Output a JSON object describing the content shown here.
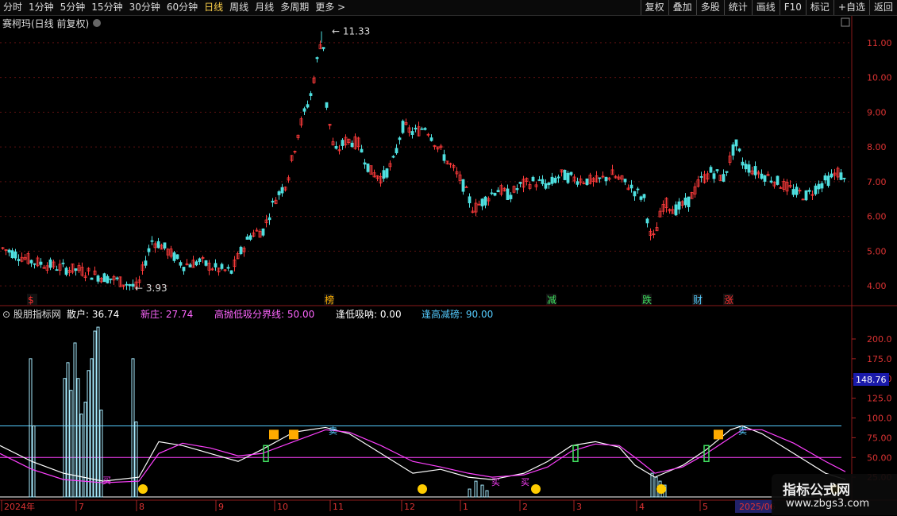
{
  "toolbar": {
    "left": [
      "分时",
      "1分钟",
      "5分钟",
      "15分钟",
      "30分钟",
      "60分钟",
      "日线",
      "周线",
      "月线",
      "多周期",
      "更多 >"
    ],
    "active": "日线",
    "right": [
      "复权",
      "叠加",
      "多股",
      "统计",
      "画线",
      "F10",
      "标记",
      "+自选",
      "返回"
    ]
  },
  "main": {
    "title": "赛柯玛(日线 前复权)",
    "high_label": "11.33",
    "low_label": "3.93",
    "y_ticks": [
      "11.00",
      "10.00",
      "9.00",
      "8.00",
      "7.00",
      "6.00",
      "5.00",
      "4.00"
    ],
    "markers": [
      "$",
      "榜",
      "减",
      "跌",
      "财",
      "涨"
    ]
  },
  "indicator": {
    "name": "股朋指标网",
    "items": [
      {
        "label": "散户: 36.74",
        "color": "#ffffff"
      },
      {
        "label": "新庄: 27.74",
        "color": "#ff66ff"
      },
      {
        "label": "高抛低吸分界线: 50.00",
        "color": "#ff66ff"
      },
      {
        "label": "逢低吸呐: 0.00",
        "color": "#ffffff"
      },
      {
        "label": "逢高减磅: 90.00",
        "color": "#55ccff"
      }
    ],
    "y_ticks": [
      "200.0",
      "175.0",
      "150.0",
      "125.0",
      "100.0",
      "75.00",
      "50.00",
      "25.00"
    ],
    "current_value": "148.76",
    "signal_text": {
      "buy": "买",
      "sell": "卖"
    }
  },
  "x_axis": {
    "labels": [
      "2024年",
      "7",
      "8",
      "9",
      "10",
      "11",
      "12",
      "1",
      "2",
      "3",
      "4",
      "5",
      "2025/06"
    ]
  },
  "watermark": {
    "line1": "指标公式网",
    "line2": "www.zbgs3.com"
  },
  "colors": {
    "up": "#ff3b3b",
    "down": "#4fe0e0",
    "grid": "#5a1010",
    "accent": "#ffd24a",
    "magenta": "#ff40ff",
    "cyan": "#55ccff"
  },
  "chart_data": {
    "type": "candlestick",
    "price_range": [
      3.5,
      11.5
    ],
    "price_path": [
      [
        0,
        5.1
      ],
      [
        20,
        4.9
      ],
      [
        40,
        4.7
      ],
      [
        60,
        4.6
      ],
      [
        80,
        4.5
      ],
      [
        100,
        4.45
      ],
      [
        120,
        4.3
      ],
      [
        140,
        4.2
      ],
      [
        160,
        4.05
      ],
      [
        172,
        3.93
      ],
      [
        180,
        4.6
      ],
      [
        190,
        5.3
      ],
      [
        200,
        5.2
      ],
      [
        215,
        4.9
      ],
      [
        230,
        4.6
      ],
      [
        250,
        4.7
      ],
      [
        270,
        4.5
      ],
      [
        290,
        4.4
      ],
      [
        300,
        4.9
      ],
      [
        315,
        5.5
      ],
      [
        330,
        5.6
      ],
      [
        345,
        6.5
      ],
      [
        360,
        7.0
      ],
      [
        375,
        8.5
      ],
      [
        390,
        9.5
      ],
      [
        405,
        11.33
      ],
      [
        410,
        9.2
      ],
      [
        420,
        7.8
      ],
      [
        435,
        8.2
      ],
      [
        450,
        8.1
      ],
      [
        465,
        7.3
      ],
      [
        480,
        7.1
      ],
      [
        495,
        7.6
      ],
      [
        505,
        8.6
      ],
      [
        520,
        8.4
      ],
      [
        535,
        8.6
      ],
      [
        550,
        8.0
      ],
      [
        565,
        7.5
      ],
      [
        580,
        7.0
      ],
      [
        595,
        6.2
      ],
      [
        610,
        6.5
      ],
      [
        625,
        6.8
      ],
      [
        640,
        6.6
      ],
      [
        655,
        6.9
      ],
      [
        670,
        7.0
      ],
      [
        690,
        6.9
      ],
      [
        705,
        7.2
      ],
      [
        720,
        7.1
      ],
      [
        735,
        7.05
      ],
      [
        750,
        7.0
      ],
      [
        770,
        7.2
      ],
      [
        790,
        6.9
      ],
      [
        810,
        6.5
      ],
      [
        820,
        5.2
      ],
      [
        835,
        6.4
      ],
      [
        850,
        6.2
      ],
      [
        865,
        6.4
      ],
      [
        880,
        7.0
      ],
      [
        895,
        7.3
      ],
      [
        910,
        7.1
      ],
      [
        925,
        8.1
      ],
      [
        935,
        7.5
      ],
      [
        950,
        7.3
      ],
      [
        970,
        7.1
      ],
      [
        985,
        6.9
      ],
      [
        1000,
        6.7
      ],
      [
        1015,
        6.6
      ],
      [
        1030,
        6.9
      ],
      [
        1045,
        7.1
      ],
      [
        1055,
        7.3
      ],
      [
        1062,
        7.0
      ]
    ],
    "osc_white": [
      [
        0,
        65
      ],
      [
        40,
        45
      ],
      [
        80,
        30
      ],
      [
        130,
        20
      ],
      [
        175,
        25
      ],
      [
        200,
        70
      ],
      [
        230,
        65
      ],
      [
        265,
        55
      ],
      [
        300,
        45
      ],
      [
        330,
        60
      ],
      [
        370,
        82
      ],
      [
        410,
        88
      ],
      [
        440,
        80
      ],
      [
        480,
        55
      ],
      [
        520,
        30
      ],
      [
        555,
        35
      ],
      [
        590,
        25
      ],
      [
        620,
        22
      ],
      [
        660,
        30
      ],
      [
        690,
        45
      ],
      [
        720,
        65
      ],
      [
        750,
        70
      ],
      [
        780,
        63
      ],
      [
        800,
        40
      ],
      [
        825,
        25
      ],
      [
        860,
        40
      ],
      [
        890,
        60
      ],
      [
        920,
        85
      ],
      [
        935,
        90
      ],
      [
        960,
        80
      ],
      [
        1000,
        55
      ],
      [
        1040,
        30
      ],
      [
        1065,
        22
      ]
    ],
    "osc_magenta": [
      [
        0,
        55
      ],
      [
        40,
        35
      ],
      [
        80,
        22
      ],
      [
        130,
        18
      ],
      [
        175,
        20
      ],
      [
        200,
        55
      ],
      [
        230,
        68
      ],
      [
        265,
        62
      ],
      [
        300,
        52
      ],
      [
        330,
        55
      ],
      [
        370,
        70
      ],
      [
        410,
        85
      ],
      [
        440,
        82
      ],
      [
        480,
        65
      ],
      [
        520,
        45
      ],
      [
        555,
        38
      ],
      [
        590,
        30
      ],
      [
        620,
        25
      ],
      [
        660,
        28
      ],
      [
        690,
        38
      ],
      [
        720,
        58
      ],
      [
        750,
        67
      ],
      [
        780,
        65
      ],
      [
        800,
        50
      ],
      [
        825,
        30
      ],
      [
        860,
        38
      ],
      [
        890,
        55
      ],
      [
        920,
        75
      ],
      [
        935,
        85
      ],
      [
        960,
        85
      ],
      [
        1000,
        68
      ],
      [
        1040,
        45
      ],
      [
        1065,
        32
      ]
    ],
    "histogram": [
      [
        37,
        175
      ],
      [
        41,
        90
      ],
      [
        80,
        150
      ],
      [
        84,
        170
      ],
      [
        88,
        135
      ],
      [
        93,
        195
      ],
      [
        97,
        150
      ],
      [
        101,
        105
      ],
      [
        106,
        120
      ],
      [
        110,
        160
      ],
      [
        114,
        175
      ],
      [
        118,
        210
      ],
      [
        122,
        215
      ],
      [
        126,
        110
      ],
      [
        166,
        175
      ],
      [
        170,
        95
      ],
      [
        590,
        10
      ],
      [
        598,
        20
      ],
      [
        606,
        15
      ],
      [
        612,
        8
      ],
      [
        820,
        30
      ],
      [
        825,
        25
      ],
      [
        830,
        20
      ],
      [
        836,
        15
      ]
    ]
  }
}
